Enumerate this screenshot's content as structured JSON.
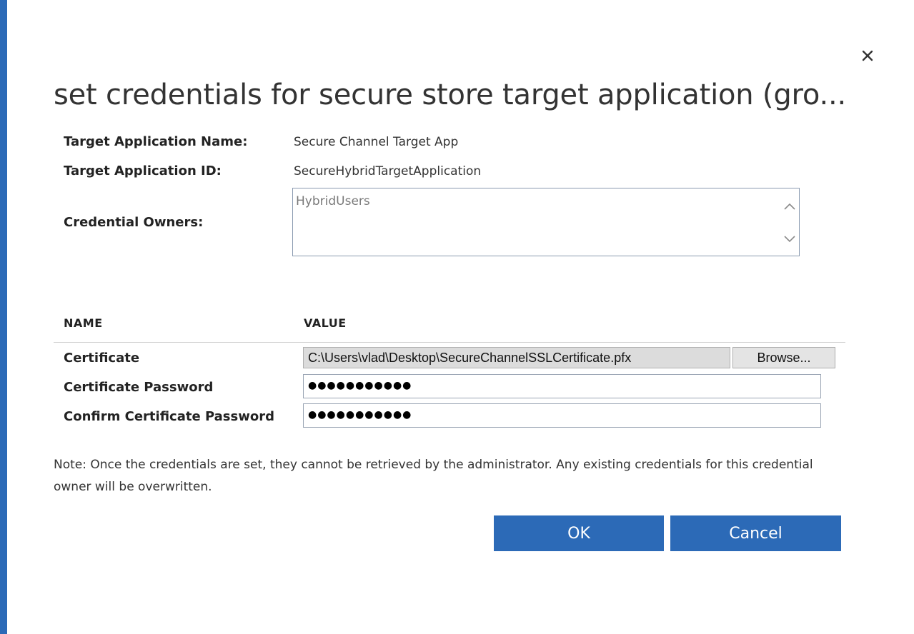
{
  "colors": {
    "accent": "#2c6ab7",
    "button_bg": "#2c6ab7",
    "button_text": "#ffffff",
    "close_icon": "#333333"
  },
  "dialog": {
    "title": "set credentials for secure store target application (gro...",
    "close_icon": "close-icon"
  },
  "fields": {
    "target_app_name_label": "Target Application Name:",
    "target_app_name_value": "Secure Channel Target App",
    "target_app_id_label": "Target Application ID:",
    "target_app_id_value": "SecureHybridTargetApplication",
    "credential_owners_label": "Credential Owners:",
    "credential_owners_value": "HybridUsers"
  },
  "credentials_table": {
    "headers": {
      "name": "NAME",
      "value": "VALUE"
    },
    "certificate": {
      "label": "Certificate",
      "path": "C:\\Users\\vlad\\Desktop\\SecureChannelSSLCertificate.pfx",
      "browse_label": "Browse..."
    },
    "certificate_password": {
      "label": "Certificate Password",
      "masked_value": "●●●●●●●●●●●"
    },
    "confirm_certificate_password": {
      "label": "Confirm Certificate Password",
      "masked_value": "●●●●●●●●●●●"
    }
  },
  "note": "Note: Once the credentials are set, they cannot be retrieved by the administrator. Any existing credentials for this credential owner will be overwritten.",
  "buttons": {
    "ok_label": "OK",
    "cancel_label": "Cancel"
  }
}
